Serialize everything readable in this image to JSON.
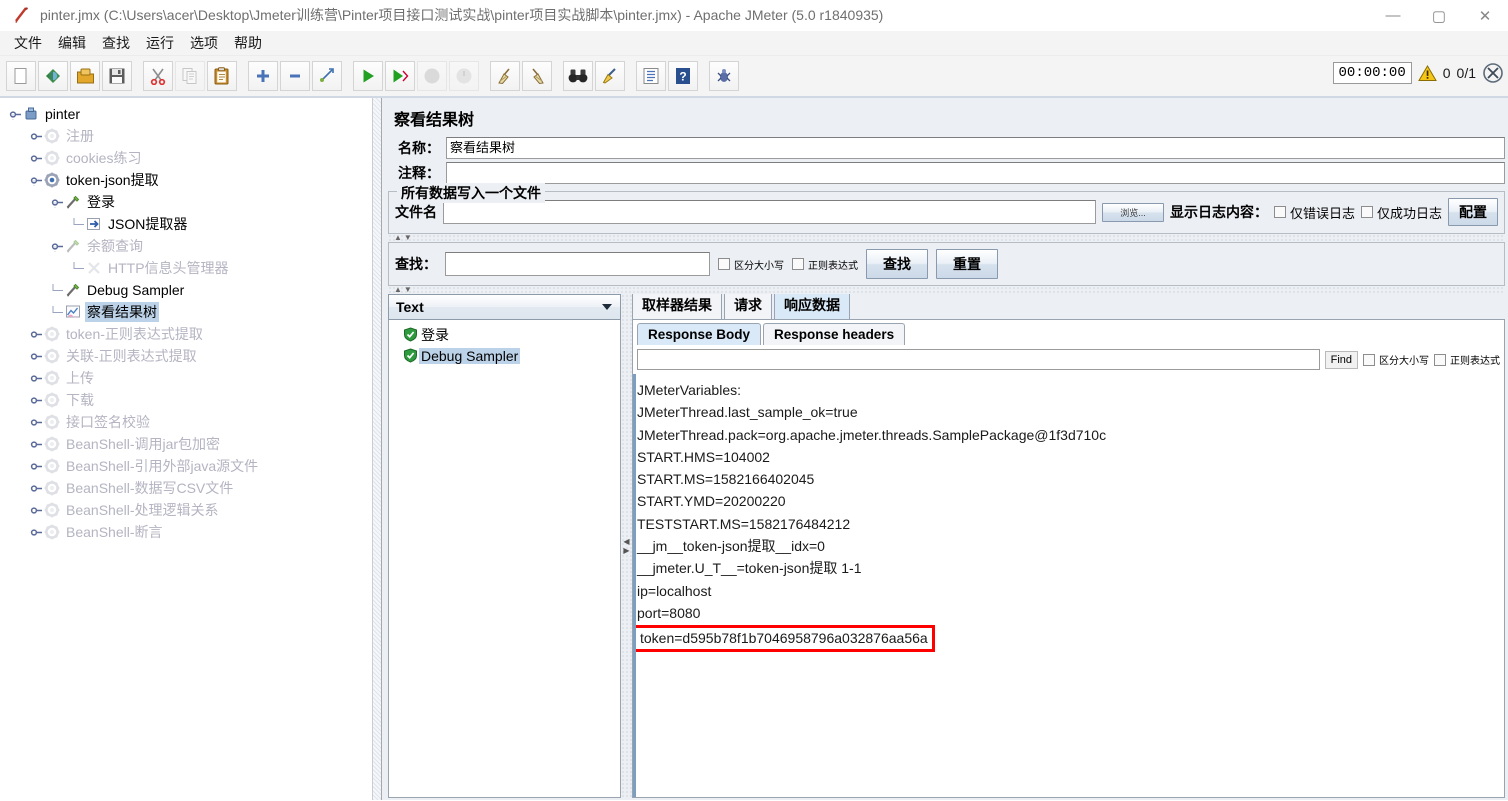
{
  "window": {
    "title": "pinter.jmx (C:\\Users\\acer\\Desktop\\Jmeter训练营\\Pinter项目接口测试实战\\pinter项目实战脚本\\pinter.jmx) - Apache JMeter (5.0 r1840935)",
    "minimize_label": "—",
    "maximize_label": "▢",
    "close_label": "✕",
    "app_icon": "jmeter-feather-icon"
  },
  "menubar": {
    "items": [
      {
        "label": "文件",
        "name": "menu-file"
      },
      {
        "label": "编辑",
        "name": "menu-edit"
      },
      {
        "label": "查找",
        "name": "menu-search"
      },
      {
        "label": "运行",
        "name": "menu-run"
      },
      {
        "label": "选项",
        "name": "menu-options"
      },
      {
        "label": "帮助",
        "name": "menu-help"
      }
    ]
  },
  "toolbar": {
    "buttons": [
      {
        "name": "new-icon",
        "glyph": "new",
        "disabled": false
      },
      {
        "name": "templates-icon",
        "glyph": "templates",
        "disabled": false
      },
      {
        "name": "open-icon",
        "glyph": "open",
        "disabled": false
      },
      {
        "name": "save-icon",
        "glyph": "save",
        "disabled": false
      },
      {
        "name": "cut-icon",
        "glyph": "cut",
        "disabled": false
      },
      {
        "name": "copy-icon",
        "glyph": "copy",
        "disabled": true
      },
      {
        "name": "paste-icon",
        "glyph": "paste",
        "disabled": false
      },
      {
        "name": "expand-all-icon",
        "glyph": "plus",
        "disabled": false
      },
      {
        "name": "collapse-all-icon",
        "glyph": "minus",
        "disabled": false
      },
      {
        "name": "toggle-icon",
        "glyph": "toggle",
        "disabled": false
      },
      {
        "name": "start-icon",
        "glyph": "play",
        "disabled": false
      },
      {
        "name": "start-no-pauses-icon",
        "glyph": "play-fast",
        "disabled": false
      },
      {
        "name": "stop-icon",
        "glyph": "stop",
        "disabled": true
      },
      {
        "name": "shutdown-icon",
        "glyph": "shutdown",
        "disabled": true
      },
      {
        "name": "clear-icon",
        "glyph": "broom-left",
        "disabled": false
      },
      {
        "name": "clear-all-icon",
        "glyph": "broom-right",
        "disabled": false
      },
      {
        "name": "search-icon",
        "glyph": "binoculars",
        "disabled": false
      },
      {
        "name": "search-reset-icon",
        "glyph": "brush",
        "disabled": false
      },
      {
        "name": "function-helper-icon",
        "glyph": "list",
        "disabled": false
      },
      {
        "name": "help-icon",
        "glyph": "help",
        "disabled": false
      },
      {
        "name": "undo-icon",
        "glyph": "bug",
        "disabled": false
      }
    ],
    "timer": "00:00:00",
    "warn_icon": "warning-triangle-icon",
    "warn_count": "0",
    "thread_count": "0/1",
    "stop_icon": "stop-threads-icon"
  },
  "tree": {
    "nodes": [
      {
        "label": "pinter",
        "depth": 0,
        "icon": "test-plan-icon",
        "handle": "expanded",
        "disabled": false,
        "selected": false
      },
      {
        "label": "注册",
        "depth": 1,
        "icon": "thread-group-icon",
        "handle": "collapsed",
        "disabled": true,
        "selected": false
      },
      {
        "label": "cookies练习",
        "depth": 1,
        "icon": "thread-group-icon",
        "handle": "collapsed",
        "disabled": true,
        "selected": false
      },
      {
        "label": "token-json提取",
        "depth": 1,
        "icon": "thread-group-active-icon",
        "handle": "expanded",
        "disabled": false,
        "selected": false
      },
      {
        "label": "登录",
        "depth": 2,
        "icon": "http-sampler-icon",
        "handle": "expanded",
        "disabled": false,
        "selected": false
      },
      {
        "label": "JSON提取器",
        "depth": 3,
        "icon": "json-extractor-icon",
        "handle": "leaf",
        "disabled": false,
        "selected": false
      },
      {
        "label": "余额查询",
        "depth": 2,
        "icon": "http-sampler-icon",
        "handle": "expanded",
        "disabled": true,
        "selected": false
      },
      {
        "label": "HTTP信息头管理器",
        "depth": 3,
        "icon": "header-manager-icon",
        "handle": "leaf",
        "disabled": true,
        "selected": false
      },
      {
        "label": "Debug Sampler",
        "depth": 2,
        "icon": "http-sampler-icon",
        "handle": "leaf",
        "disabled": false,
        "selected": false
      },
      {
        "label": "察看结果树",
        "depth": 2,
        "icon": "view-results-tree-icon",
        "handle": "leaf",
        "disabled": false,
        "selected": true
      },
      {
        "label": "token-正则表达式提取",
        "depth": 1,
        "icon": "thread-group-icon",
        "handle": "collapsed",
        "disabled": true,
        "selected": false
      },
      {
        "label": "关联-正则表达式提取",
        "depth": 1,
        "icon": "thread-group-icon",
        "handle": "collapsed",
        "disabled": true,
        "selected": false
      },
      {
        "label": "上传",
        "depth": 1,
        "icon": "thread-group-icon",
        "handle": "collapsed",
        "disabled": true,
        "selected": false
      },
      {
        "label": "下载",
        "depth": 1,
        "icon": "thread-group-icon",
        "handle": "collapsed",
        "disabled": true,
        "selected": false
      },
      {
        "label": "接口签名校验",
        "depth": 1,
        "icon": "thread-group-icon",
        "handle": "collapsed",
        "disabled": true,
        "selected": false
      },
      {
        "label": "BeanShell-调用jar包加密",
        "depth": 1,
        "icon": "thread-group-icon",
        "handle": "collapsed",
        "disabled": true,
        "selected": false
      },
      {
        "label": "BeanShell-引用外部java源文件",
        "depth": 1,
        "icon": "thread-group-icon",
        "handle": "collapsed",
        "disabled": true,
        "selected": false
      },
      {
        "label": "BeanShell-数据写CSV文件",
        "depth": 1,
        "icon": "thread-group-icon",
        "handle": "collapsed",
        "disabled": true,
        "selected": false
      },
      {
        "label": "BeanShell-处理逻辑关系",
        "depth": 1,
        "icon": "thread-group-icon",
        "handle": "collapsed",
        "disabled": true,
        "selected": false
      },
      {
        "label": "BeanShell-断言",
        "depth": 1,
        "icon": "thread-group-icon",
        "handle": "collapsed",
        "disabled": true,
        "selected": false
      }
    ]
  },
  "panel": {
    "title": "察看结果树",
    "name_label": "名称：",
    "name_value": "察看结果树",
    "comment_label": "注释：",
    "comment_value": "",
    "file_group_title": "所有数据写入一个文件",
    "filename_label": "文件名",
    "filename_value": "",
    "browse_label": "浏览...",
    "log_display_label": "显示日志内容：",
    "errors_only_label": "仅错误日志",
    "success_only_label": "仅成功日志",
    "configure_label": "配置"
  },
  "search": {
    "label": "查找：",
    "value": "",
    "case_sensitive_label": "区分大小写",
    "regex_label": "正则表达式",
    "find_button": "查找",
    "reset_button": "重置"
  },
  "results": {
    "renderer_selected": "Text",
    "items": [
      {
        "label": "登录",
        "icon": "success-shield-icon",
        "selected": false
      },
      {
        "label": "Debug Sampler",
        "icon": "success-shield-icon",
        "selected": true
      }
    ]
  },
  "tabs": {
    "outer": [
      {
        "label": "取样器结果",
        "active": false,
        "name": "tab-sampler-result"
      },
      {
        "label": "请求",
        "active": false,
        "name": "tab-request"
      },
      {
        "label": "响应数据",
        "active": true,
        "name": "tab-response-data"
      }
    ],
    "inner": [
      {
        "label": "Response Body",
        "active": true,
        "name": "tab-response-body"
      },
      {
        "label": "Response headers",
        "active": false,
        "name": "tab-response-headers"
      }
    ]
  },
  "find_bar": {
    "value": "",
    "find_label": "Find",
    "case_sensitive_label": "区分大小写",
    "regex_label": "正则表达式"
  },
  "response_body": {
    "lines": [
      {
        "text": "JMeterVariables:",
        "highlighted": false
      },
      {
        "text": "JMeterThread.last_sample_ok=true",
        "highlighted": false
      },
      {
        "text": "JMeterThread.pack=org.apache.jmeter.threads.SamplePackage@1f3d710c",
        "highlighted": false
      },
      {
        "text": "START.HMS=104002",
        "highlighted": false
      },
      {
        "text": "START.MS=1582166402045",
        "highlighted": false
      },
      {
        "text": "START.YMD=20200220",
        "highlighted": false
      },
      {
        "text": "TESTSTART.MS=1582176484212",
        "highlighted": false
      },
      {
        "text": "__jm__token-json提取__idx=0",
        "highlighted": false
      },
      {
        "text": "__jmeter.U_T__=token-json提取 1-1",
        "highlighted": false
      },
      {
        "text": "ip=localhost",
        "highlighted": false
      },
      {
        "text": "port=8080",
        "highlighted": false
      },
      {
        "text": "token=d595b78f1b7046958796a032876aa56a",
        "highlighted": true
      }
    ]
  },
  "colors": {
    "selection": "#bcd2e8",
    "highlight_box": "#ff0000",
    "panel_bg": "#eceff3",
    "active_tab": "#d9e9f7"
  }
}
